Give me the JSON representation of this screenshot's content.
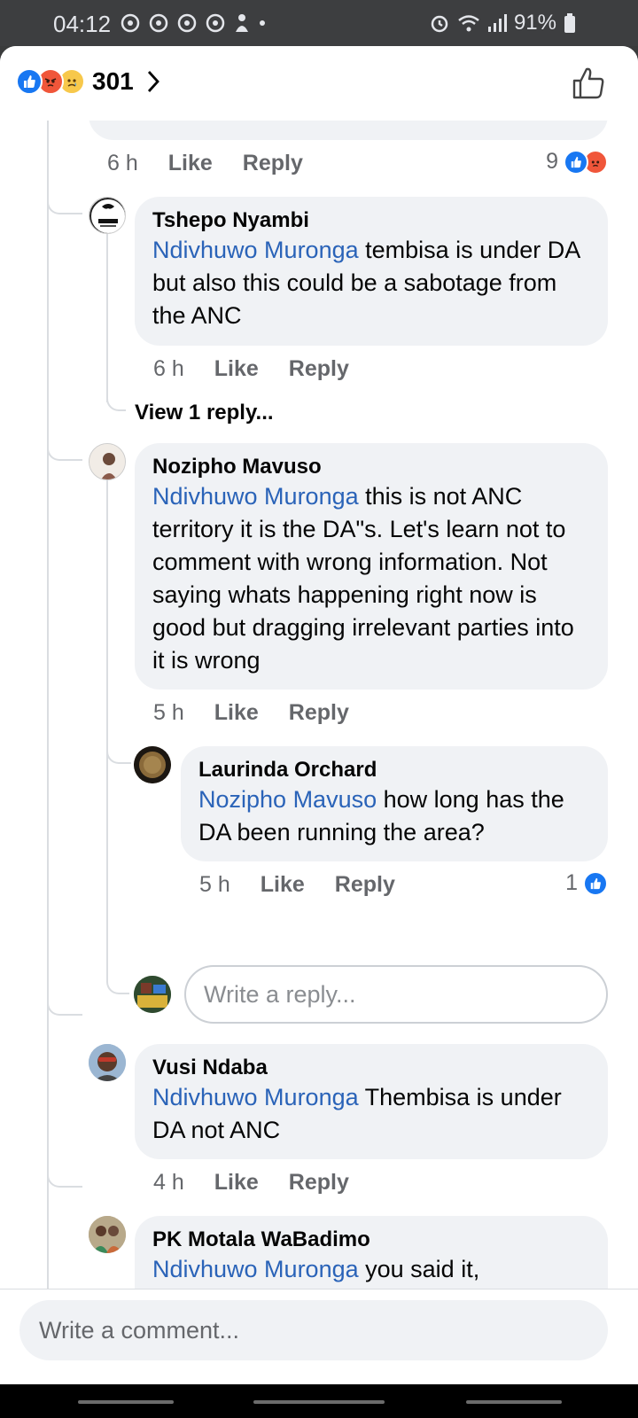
{
  "status_bar": {
    "time": "04:12",
    "battery": "91%"
  },
  "header": {
    "reaction_count": "301",
    "reactions": [
      "like-icon",
      "angry-icon",
      "sad-icon"
    ]
  },
  "top_partial": {
    "time": "6 h",
    "like": "Like",
    "reply": "Reply",
    "reaction_count": "9"
  },
  "comments": [
    {
      "name": "Tshepo Nyambi",
      "mention": "Ndivhuwo Muronga",
      "text": " tembisa is under DA but also this could be a sabotage from the ANC",
      "time": "6 h",
      "like": "Like",
      "reply": "Reply",
      "view_replies": "View 1 reply..."
    },
    {
      "name": "Nozipho Mavuso",
      "mention": "Ndivhuwo Muronga",
      "text": " this is not ANC territory  it is the DA\"s. Let's learn not to comment with wrong information. Not saying whats happening right now is good but dragging irrelevant parties into it is wrong",
      "time": "5 h",
      "like": "Like",
      "reply": "Reply"
    },
    {
      "name": "Laurinda Orchard",
      "mention": "Nozipho Mavuso",
      "text": " how long has the DA been running the area?",
      "time": "5 h",
      "like": "Like",
      "reply": "Reply",
      "reaction_count": "1"
    },
    {
      "name": "Vusi Ndaba",
      "mention": "Ndivhuwo Muronga",
      "text": " Thembisa is under DA not ANC",
      "time": "4 h",
      "like": "Like",
      "reply": "Reply"
    },
    {
      "name": "PK Motala WaBadimo",
      "mention": "Ndivhuwo Muronga",
      "text": " you said it, everything happening there is Anc.",
      "time": "",
      "like": "",
      "reply": ""
    }
  ],
  "reply_placeholder": "Write a reply...",
  "comment_placeholder": "Write a comment...",
  "colors": {
    "link": "#2a63b8",
    "bubble": "#f0f2f5",
    "like_blue": "#1877f2",
    "angry_orange": "#f0563a"
  }
}
